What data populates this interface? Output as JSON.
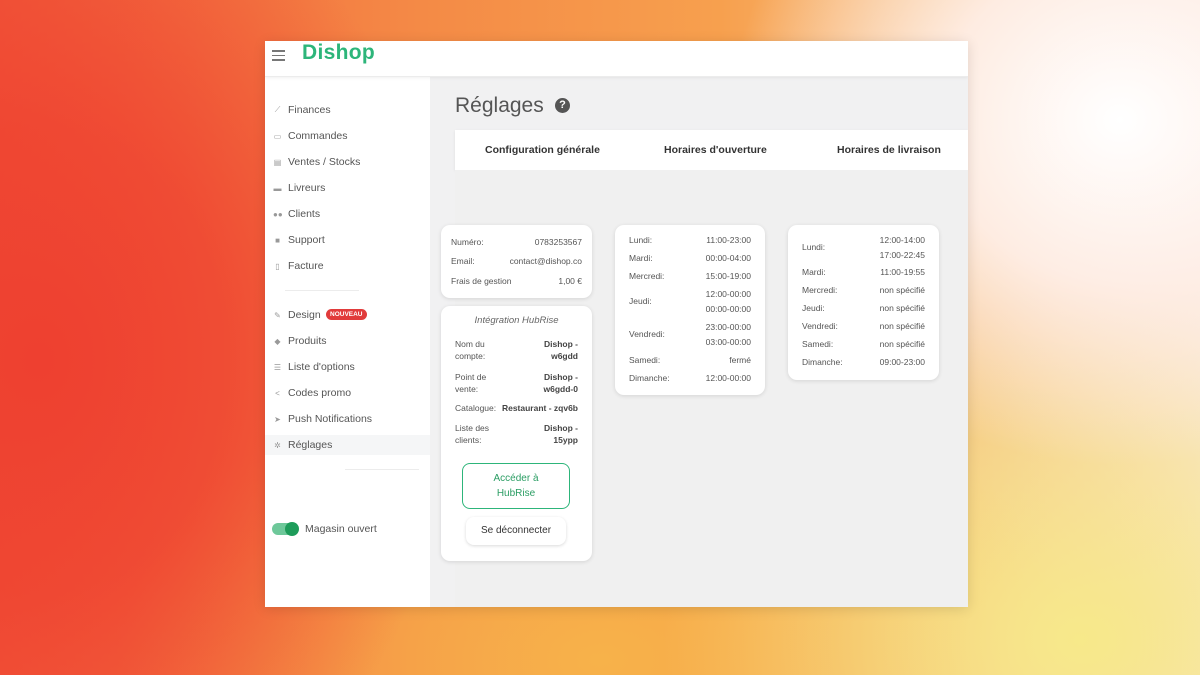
{
  "app": {
    "logo": "Dishop"
  },
  "sidebar": {
    "items": [
      {
        "label": "Finances",
        "icon": "chart-line-icon"
      },
      {
        "label": "Commandes",
        "icon": "cart-icon"
      },
      {
        "label": "Ventes / Stocks",
        "icon": "box-icon"
      },
      {
        "label": "Livreurs",
        "icon": "car-icon"
      },
      {
        "label": "Clients",
        "icon": "users-icon"
      },
      {
        "label": "Support",
        "icon": "database-icon"
      },
      {
        "label": "Facture",
        "icon": "file-icon"
      },
      {
        "label": "Design",
        "icon": "brush-icon",
        "badge": "NOUVEAU"
      },
      {
        "label": "Produits",
        "icon": "tag-icon"
      },
      {
        "label": "Liste d'options",
        "icon": "list-icon"
      },
      {
        "label": "Codes promo",
        "icon": "share-icon"
      },
      {
        "label": "Push Notifications",
        "icon": "send-icon"
      },
      {
        "label": "Réglages",
        "icon": "gear-icon"
      }
    ],
    "store_toggle": {
      "label": "Magasin ouvert",
      "on": true
    }
  },
  "page": {
    "title": "Réglages"
  },
  "tabs": [
    "Configuration générale",
    "Horaires d'ouverture",
    "Horaires de livraison"
  ],
  "config": {
    "numero_label": "Numéro:",
    "numero": "0783253567",
    "email_label": "Email:",
    "email": "contact@dishop.co",
    "frais_label": "Frais de gestion",
    "frais": "1,00 €"
  },
  "hubrise": {
    "title": "Intégration HubRise",
    "compte_label": [
      "Nom du",
      "compte:"
    ],
    "compte": [
      "Dishop -",
      "w6gdd"
    ],
    "pdv_label": [
      "Point de",
      "vente:"
    ],
    "pdv": [
      "Dishop -",
      "w6gdd-0"
    ],
    "catalogue_label": "Catalogue:",
    "catalogue": "Restaurant - zqv6b",
    "clients_label": [
      "Liste des",
      "clients:"
    ],
    "clients": [
      "Dishop -",
      "15ypp"
    ],
    "access_button": [
      "Accéder à",
      "HubRise"
    ],
    "logout_button": "Se déconnecter"
  },
  "opening_hours": [
    {
      "day": "Lundi:",
      "hours": [
        "11:00-23:00"
      ]
    },
    {
      "day": "Mardi:",
      "hours": [
        "00:00-04:00"
      ]
    },
    {
      "day": "Mercredi:",
      "hours": [
        "15:00-19:00"
      ]
    },
    {
      "day": "Jeudi:",
      "hours": [
        "12:00-00:00",
        "00:00-00:00"
      ]
    },
    {
      "day": "Vendredi:",
      "hours": [
        "23:00-00:00",
        "03:00-00:00"
      ]
    },
    {
      "day": "Samedi:",
      "hours": [
        "fermé"
      ]
    },
    {
      "day": "Dimanche:",
      "hours": [
        "12:00-00:00"
      ]
    }
  ],
  "delivery_hours": [
    {
      "day": "Lundi:",
      "hours": [
        "12:00-14:00",
        "17:00-22:45"
      ]
    },
    {
      "day": "Mardi:",
      "hours": [
        "11:00-19:55"
      ]
    },
    {
      "day": "Mercredi:",
      "hours": [
        "non spécifié"
      ]
    },
    {
      "day": "Jeudi:",
      "hours": [
        "non spécifié"
      ]
    },
    {
      "day": "Vendredi:",
      "hours": [
        "non spécifié"
      ]
    },
    {
      "day": "Samedi:",
      "hours": [
        "non spécifié"
      ]
    },
    {
      "day": "Dimanche:",
      "hours": [
        "09:00-23:00"
      ]
    }
  ]
}
